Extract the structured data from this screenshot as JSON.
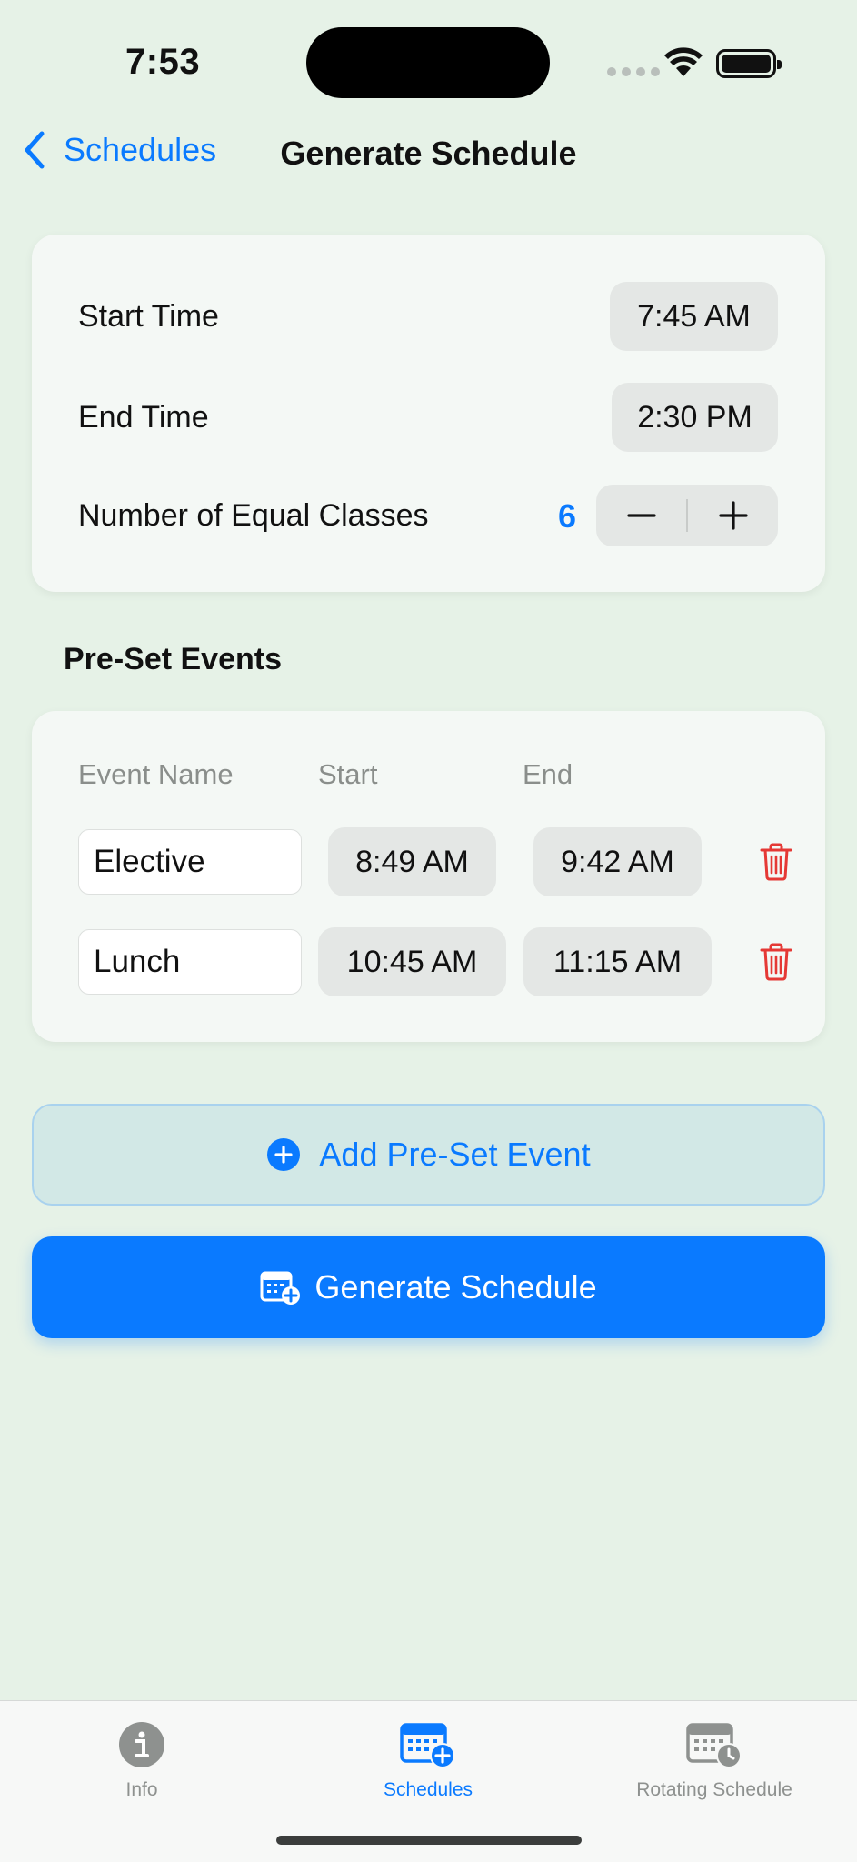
{
  "status_bar": {
    "time": "7:53"
  },
  "nav": {
    "back_label": "Schedules",
    "title": "Generate Schedule"
  },
  "settings": {
    "start_time_label": "Start Time",
    "start_time_value": "7:45 AM",
    "end_time_label": "End Time",
    "end_time_value": "2:30 PM",
    "classes_label": "Number of Equal Classes",
    "classes_count": "6"
  },
  "preset": {
    "section_title": "Pre-Set Events",
    "headers": {
      "name": "Event Name",
      "start": "Start",
      "end": "End"
    },
    "events": [
      {
        "name": "Elective",
        "start": "8:49 AM",
        "end": "9:42 AM"
      },
      {
        "name": "Lunch",
        "start": "10:45 AM",
        "end": "11:15 AM"
      }
    ]
  },
  "actions": {
    "add_label": "Add Pre-Set Event",
    "generate_label": "Generate Schedule"
  },
  "tabbar": {
    "tabs": [
      {
        "label": "Info",
        "icon": "info-icon",
        "active": false
      },
      {
        "label": "Schedules",
        "icon": "calendar-plus-icon",
        "active": true
      },
      {
        "label": "Rotating Schedule",
        "icon": "calendar-clock-icon",
        "active": false
      }
    ]
  },
  "colors": {
    "accent": "#0a7aff",
    "background": "#e6f2e7",
    "destructive": "#e53935"
  }
}
